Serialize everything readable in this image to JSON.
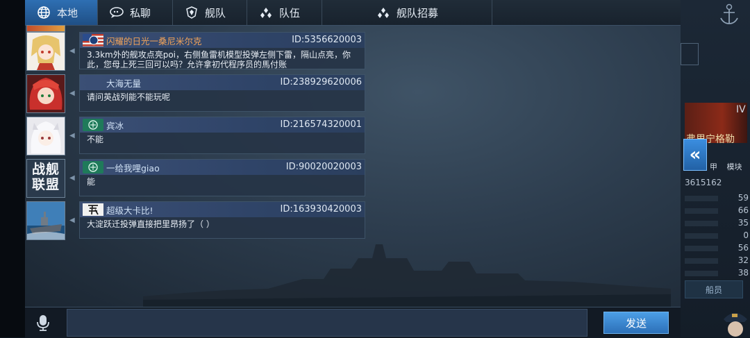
{
  "tabs": [
    {
      "label": "本地",
      "icon": "globe-icon",
      "active": true
    },
    {
      "label": "私聊",
      "icon": "chat-bubble-icon",
      "active": false
    },
    {
      "label": "舰队",
      "icon": "fleet-shield-icon",
      "active": false
    },
    {
      "label": "队伍",
      "icon": "team-dots-icon",
      "active": false
    },
    {
      "label": "舰队招募",
      "icon": "recruit-dots-icon",
      "active": false
    }
  ],
  "messages": [
    {
      "sender": "闪耀的日光一桑尼米尔克",
      "id": "ID:5356620003",
      "text": "3.3km外的舰攻点亮poi，右侧鱼雷机模型投弹左侧下雷，隔山点亮，你此，您母上死三回可以吗？允许拿初代程序员的馬付账",
      "badge": "us-flag-badge",
      "name_color": "#f0a35a"
    },
    {
      "sender": "大海无量",
      "id": "ID:238929620006",
      "text": "请问英战列能不能玩呢",
      "badge": "",
      "name_color": "#cfe0f4"
    },
    {
      "sender": "宾冰",
      "id": "ID:216574320001",
      "text": "不能",
      "badge": "green-emblem-badge",
      "name_color": "#cfe0f4"
    },
    {
      "sender": "一给我哩giao",
      "id": "ID:90020020003",
      "text": "能",
      "badge": "green-emblem-badge",
      "name_color": "#cfe0f4"
    },
    {
      "sender": "超级大卡比!",
      "id": "ID:163930420003",
      "text": "大淀跃迁投弹直接把里昂扬了（ ）",
      "badge": "calligraphy-badge",
      "name_color": "#cfe0f4"
    }
  ],
  "avatar_logo_text": "战舰联盟",
  "send_label": "发送",
  "input_value": "",
  "right_panel": {
    "level": "IV",
    "ship_name": "弗里宁格勒",
    "labels": [
      "甲",
      "模块"
    ],
    "id_text": "3615162",
    "stats": [
      "59",
      "66",
      "35",
      "0",
      "56",
      "32",
      "38"
    ],
    "crew_button": "船员"
  }
}
